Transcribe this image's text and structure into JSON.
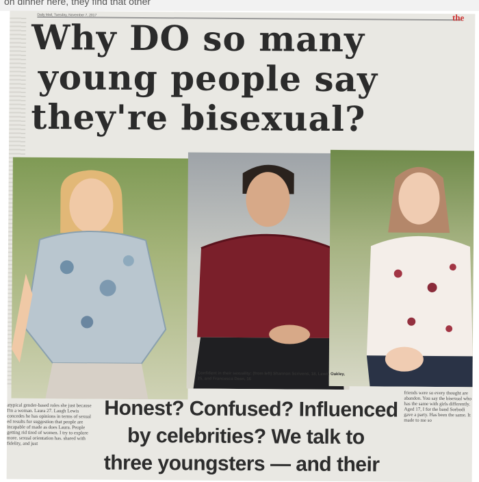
{
  "above_fold": {
    "snippet": "on dinner here, they find that other"
  },
  "newspaper": {
    "dateline": "Daily Mail, Tuesday, November 7, 2017",
    "corner_tag": "the",
    "headline_lines": [
      "Why DO so many",
      "young people say",
      "they're bisexual?"
    ],
    "photo_caption": "Confident in their sexuality: (from left) Shannon Scrivens, 18, Lewis Oakley, 25, and Francesca Dean, 16",
    "standfirst_lines": [
      "Honest? Confused? Influenced",
      "by celebrities? We talk to",
      "three youngsters — and their"
    ],
    "body_left": "atypical gender-based roles she just because I'm a woman. Laura 27. Laugh Lewis concedes he has opinions in terms of sexual ed results for suggestion that people are incapable of made as does Laura. People getting rid tired of women. I try to explore more. sexual orientation has. shared with fidelity, and just",
    "body_right": "friends were so every thought are abandon. You say the bisexual who has the same with girls differently. Aged 17, I for the band Sorbodi gave a party. Has been the same. It made to me so"
  }
}
